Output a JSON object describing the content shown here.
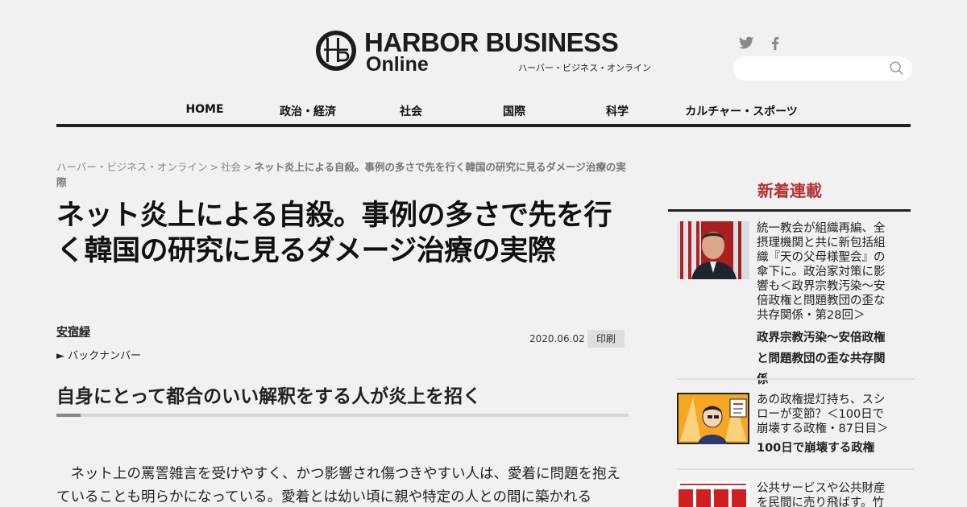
{
  "header": {
    "logo_title": "HARBOR BUSINESS",
    "logo_sub": "Online",
    "logo_kana": "ハーバー・ビジネス・オンライン",
    "search_placeholder": ""
  },
  "nav": {
    "items": [
      {
        "label": "HOME"
      },
      {
        "label": "政治・経済"
      },
      {
        "label": "社会"
      },
      {
        "label": "国際"
      },
      {
        "label": "科学"
      },
      {
        "label": "カルチャー・スポーツ"
      }
    ]
  },
  "breadcrumb": {
    "home": "ハーバー・ビジネス・オンライン",
    "section": "社会",
    "separator": ">",
    "current": "ネット炎上による自殺。事例の多さで先を行く韓国の研究に見るダメージ治療の実際"
  },
  "article": {
    "title": "ネット炎上による自殺。事例の多さで先を行く韓国の研究に見るダメージ治療の実際",
    "author": "安宿緑",
    "backnumber": "► バックナンバー",
    "date": "2020.06.02",
    "print_label": "印刷",
    "subheading": "自身にとって都合のいい解釈をする人が炎上を招く",
    "body": "　ネット上の罵詈雑言を受けやすく、かつ影響され傷つきやすい人は、愛着に問題を抱えていることも明らかになっている。愛着とは幼い頃に親や特定の人との間に築かれる"
  },
  "sidebar": {
    "title": "新着連載",
    "items": [
      {
        "headline": "統一教会が組織再編、全摂理機関と共に新包括組織『天の父母様聖会』の傘下に。政治家対策に影響も＜政界宗教汚染～安倍政権と問題教団の歪な共存関係・第28回＞",
        "series": "政界宗教汚染〜安倍政権と問題教団の歪な共存関係"
      },
      {
        "headline": "あの政権提灯持ち、スシローが変節？＜100日で崩壊する政権・87日目＞",
        "series": "100日で崩壊する政権"
      },
      {
        "headline": "公共サービスや公共財産を民間に売り飛ばす。竹中平",
        "series": ""
      }
    ]
  },
  "colors": {
    "background": "#f1f1f1",
    "sidebar_title": "#b43232",
    "rule": "#222222"
  }
}
